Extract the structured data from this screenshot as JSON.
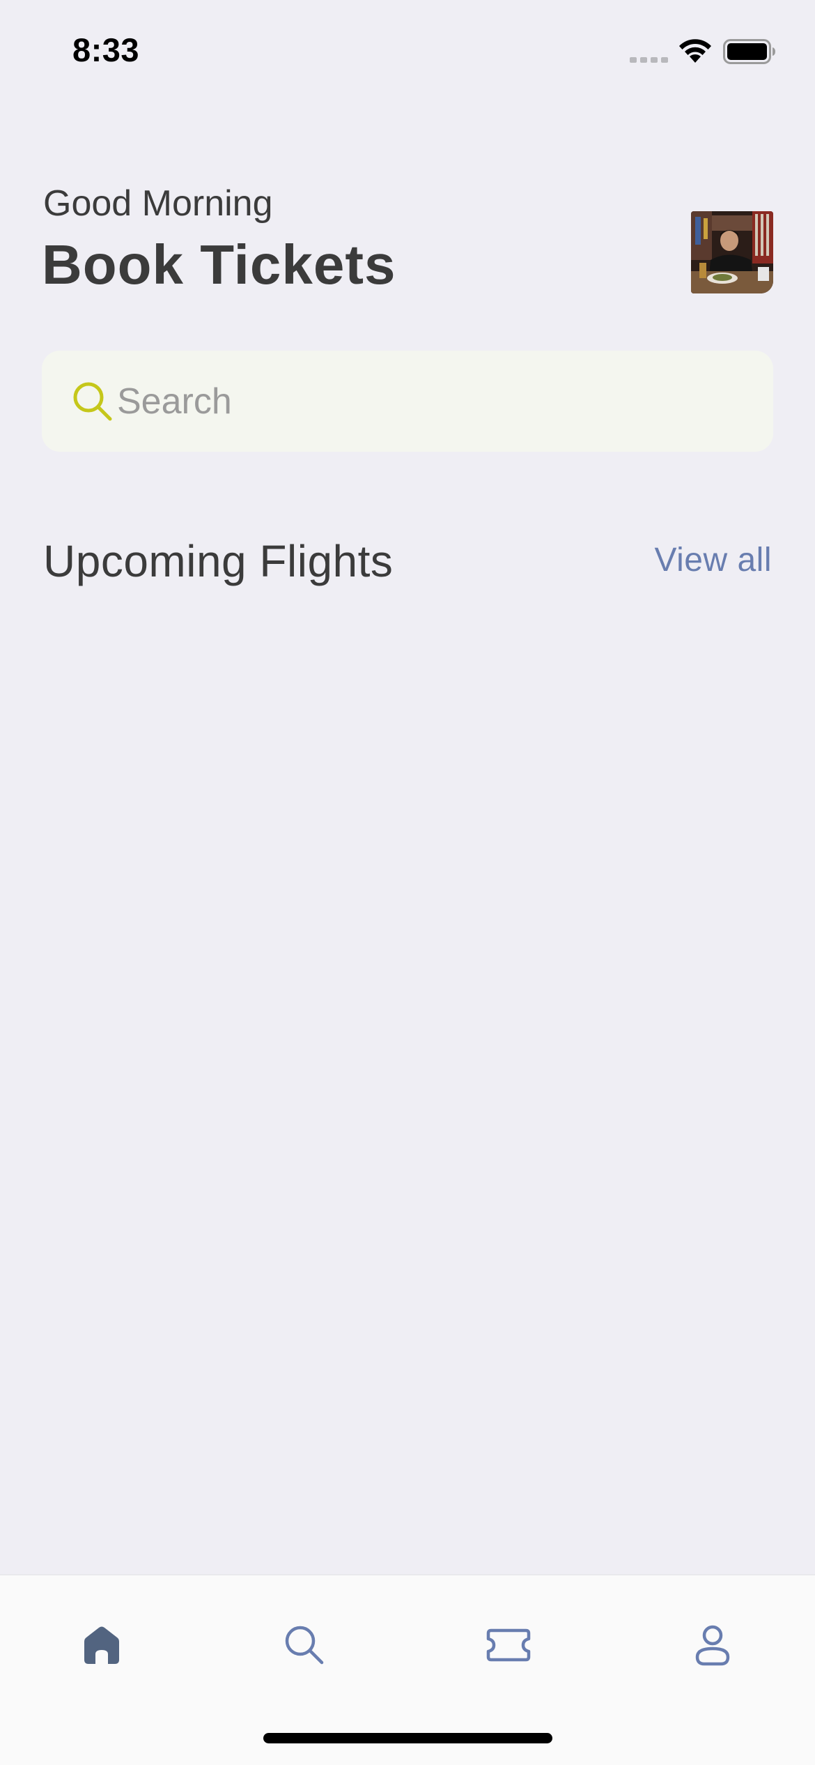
{
  "status_bar": {
    "time": "8:33"
  },
  "header": {
    "greeting": "Good Morning",
    "title": "Book Tickets"
  },
  "search": {
    "placeholder": "Search",
    "value": ""
  },
  "upcoming": {
    "title": "Upcoming Flights",
    "view_all_label": "View all"
  },
  "bottom_nav": {
    "items": [
      {
        "icon": "home-icon",
        "active": true
      },
      {
        "icon": "search-icon",
        "active": false
      },
      {
        "icon": "ticket-icon",
        "active": false
      },
      {
        "icon": "person-icon",
        "active": false
      }
    ]
  },
  "colors": {
    "background": "#efeef4",
    "text_primary": "#3b3b3b",
    "link": "#687daf",
    "search_icon": "#c5c71a",
    "search_bg": "#f4f6ef",
    "nav_active": "#526480",
    "nav_inactive": "#687daf"
  }
}
